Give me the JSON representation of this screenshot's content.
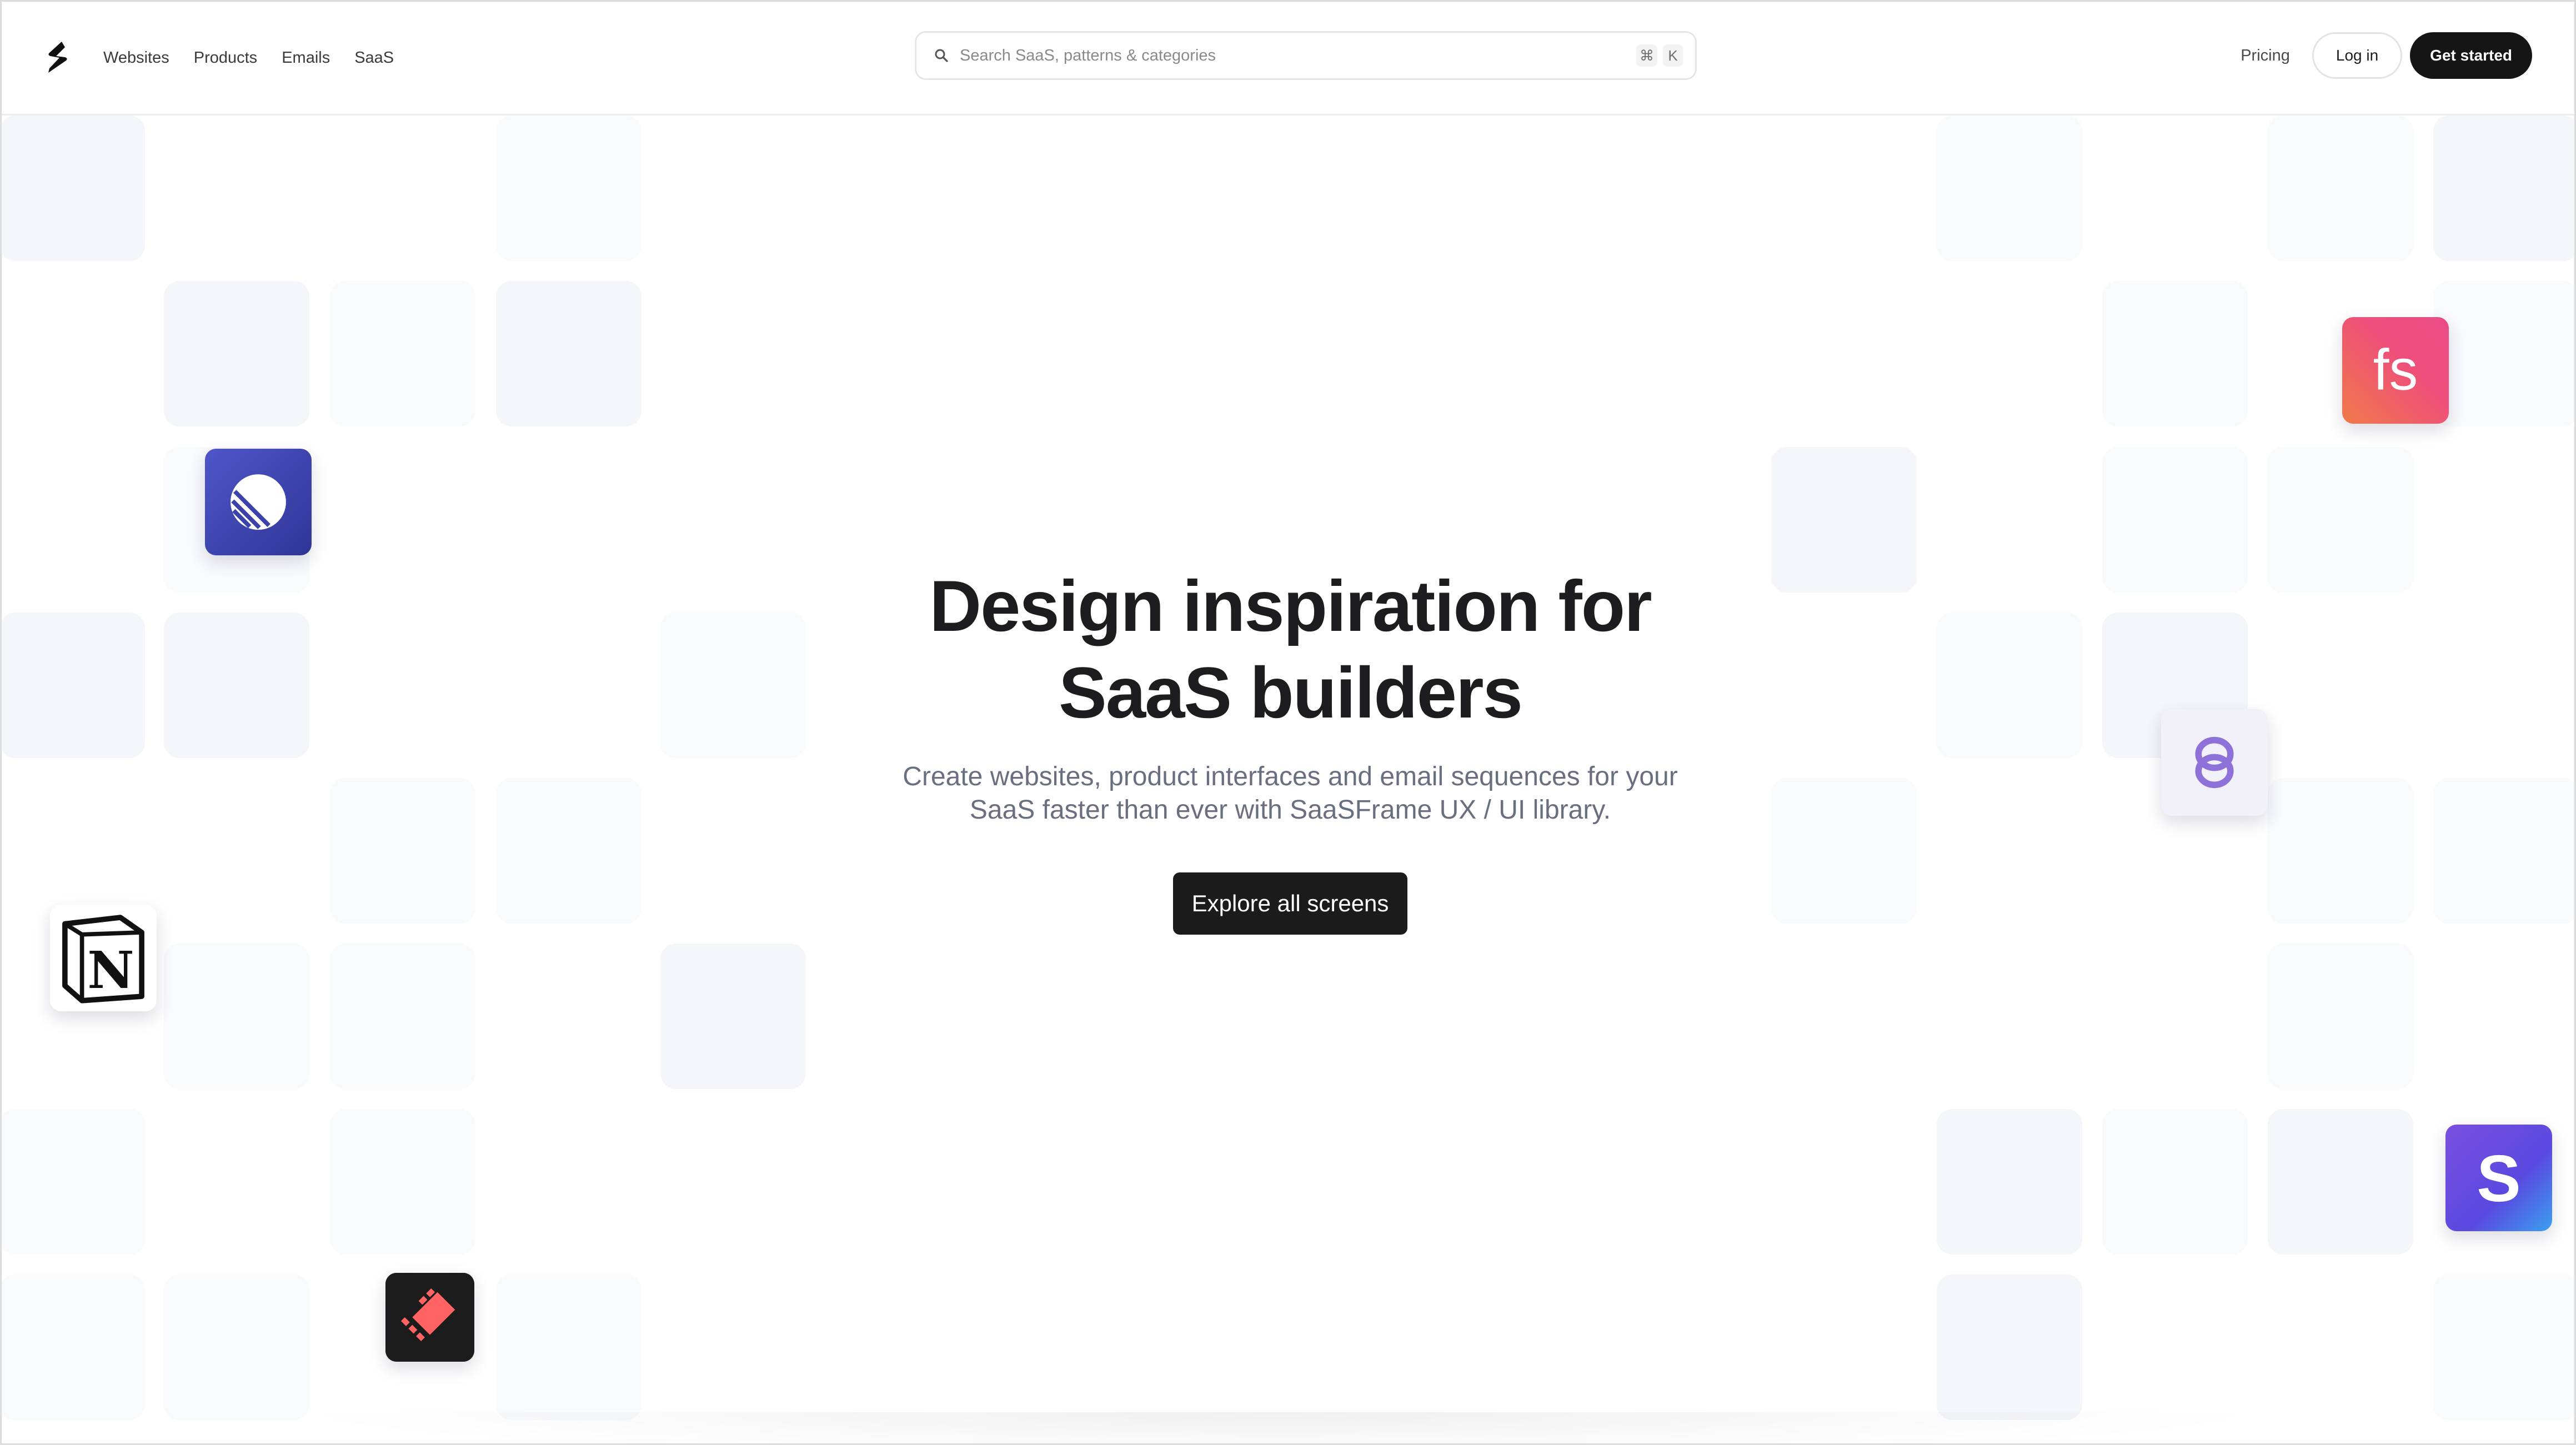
{
  "nav": {
    "logo_icon": "saasframe-logo-icon",
    "items": [
      {
        "label": "Websites"
      },
      {
        "label": "Products"
      },
      {
        "label": "Emails"
      },
      {
        "label": "SaaS"
      }
    ]
  },
  "search": {
    "placeholder": "Search SaaS, patterns & categories",
    "value": "",
    "shortcut": [
      "⌘",
      "K"
    ]
  },
  "header_right": {
    "pricing": "Pricing",
    "login": "Log in",
    "get_started": "Get started"
  },
  "hero": {
    "title_line1": "Design inspiration for",
    "title_line2": "SaaS builders",
    "subtitle": "Create websites, product interfaces and email sequences for your SaaS faster than ever with SaaSFrame UX / UI library.",
    "cta": "Explore all screens"
  },
  "app_icons": [
    {
      "name": "linear-app-icon",
      "color": "#3c44b0"
    },
    {
      "name": "notion-app-icon",
      "color": "#000000"
    },
    {
      "name": "raycast-app-icon",
      "color": "#ff6363"
    },
    {
      "name": "fs-app-icon",
      "text": "fs",
      "color": "#ee4e7b"
    },
    {
      "name": "rings-app-icon",
      "color": "#8d6fd7"
    },
    {
      "name": "stripe-app-icon",
      "text": "S",
      "color": "#5a49e0"
    }
  ],
  "colors": {
    "tile": "#f5f6fa",
    "primary_button": "#151515",
    "subtitle": "#6a6f80"
  }
}
